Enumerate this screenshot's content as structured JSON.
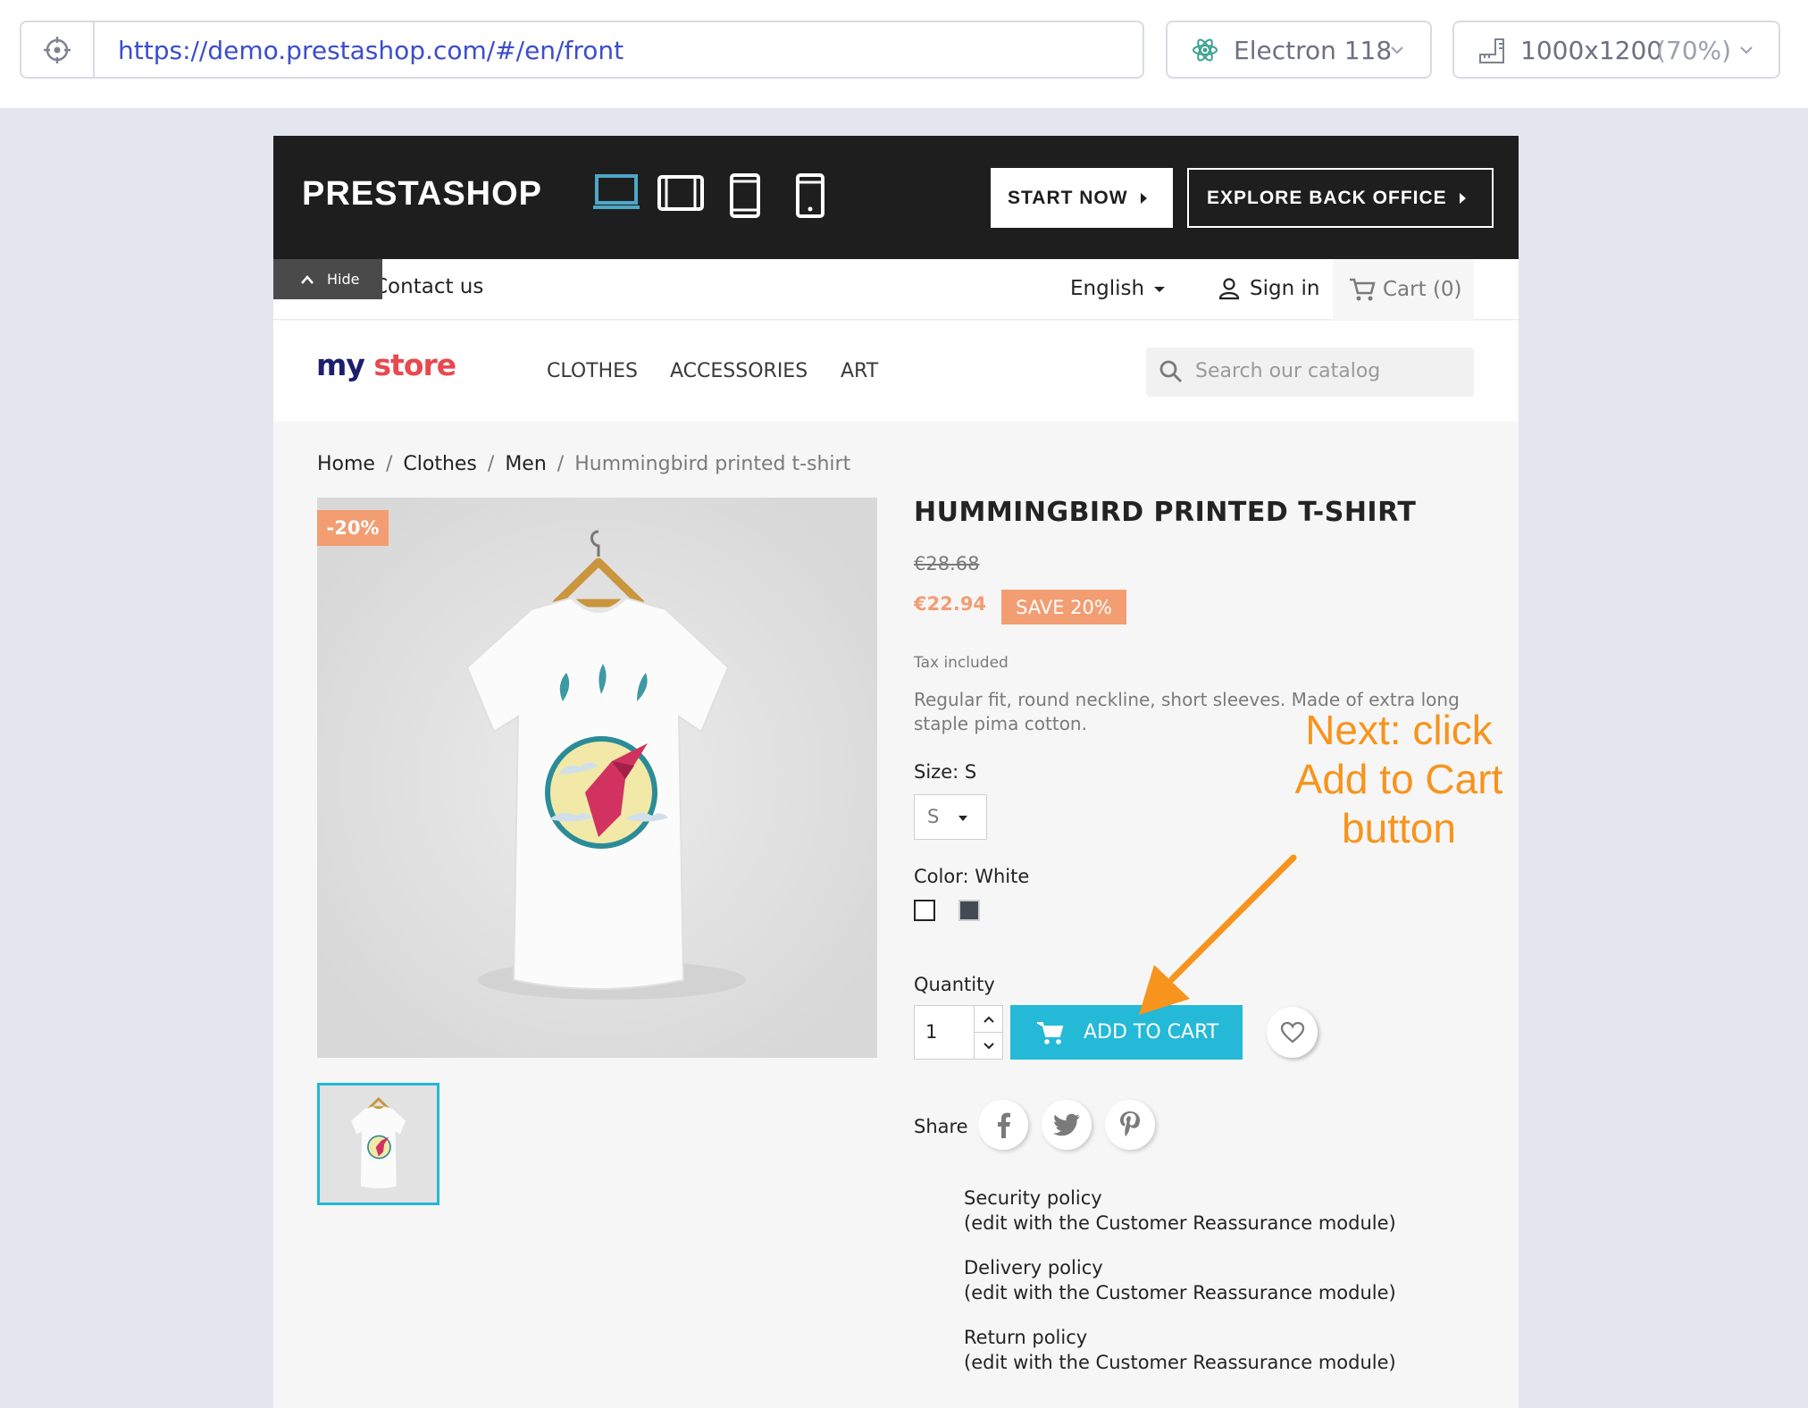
{
  "browser": {
    "url": "https://demo.prestashop.com/#/en/front",
    "engine_label": "Electron 118",
    "viewport_size": "1000x1200",
    "viewport_zoom": "(70%)"
  },
  "demo_header": {
    "logo": "PRESTASHOP",
    "start_now": "START NOW",
    "explore": "EXPLORE BACK OFFICE"
  },
  "nav": {
    "hide": "Hide",
    "contact": "Contact us",
    "language": "English",
    "signin": "Sign in",
    "cart": "Cart (0)"
  },
  "store": {
    "logo_my": "my",
    "logo_store": "store",
    "menu": [
      "CLOTHES",
      "ACCESSORIES",
      "ART"
    ],
    "search_placeholder": "Search our catalog"
  },
  "breadcrumb": [
    "Home",
    "Clothes",
    "Men",
    "Hummingbird printed t-shirt"
  ],
  "product": {
    "discount_flag": "-20%",
    "title": "HUMMINGBIRD PRINTED T-SHIRT",
    "old_price": "€28.68",
    "price": "€22.94",
    "save": "SAVE 20%",
    "tax": "Tax included",
    "description": "Regular fit, round neckline, short sleeves. Made of extra long staple pima cotton.",
    "size_label": "Size: S",
    "size_value": "S",
    "color_label": "Color: White",
    "colors": [
      "#ffffff",
      "#434a54"
    ],
    "quantity_label": "Quantity",
    "quantity": "1",
    "add_to_cart": "ADD TO CART",
    "share_label": "Share"
  },
  "reassurance": [
    {
      "title": "Security policy",
      "sub": "(edit with the Customer Reassurance module)"
    },
    {
      "title": "Delivery policy",
      "sub": "(edit with the Customer Reassurance module)"
    },
    {
      "title": "Return policy",
      "sub": "(edit with the Customer Reassurance module)"
    }
  ],
  "annotation": {
    "line1": "Next: click",
    "line2": "Add to Cart",
    "line3": "button"
  },
  "colors": {
    "accent": "#24b9d7",
    "discount": "#f39d72",
    "annotation": "#f7941d",
    "url": "#3b4dcc"
  }
}
